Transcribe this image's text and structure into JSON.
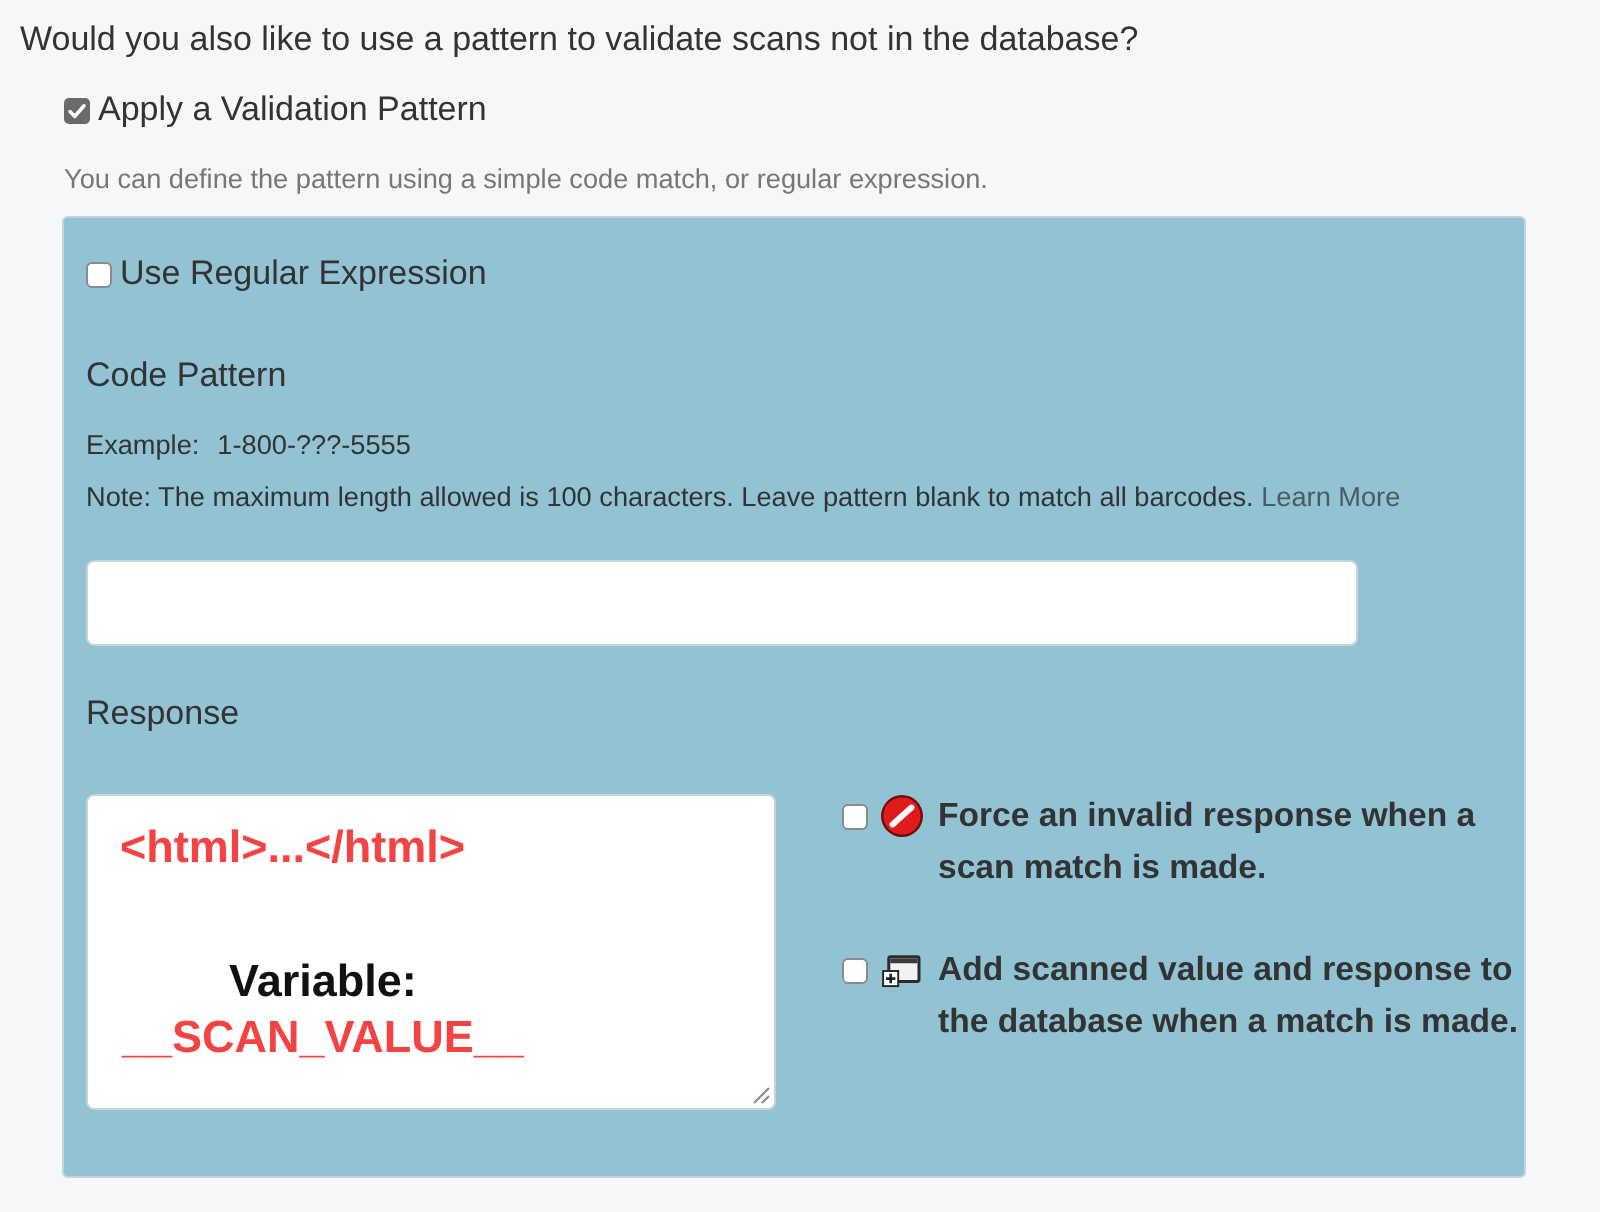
{
  "question": "Would you also like to use a pattern to validate scans not in the database?",
  "apply_pattern": {
    "label": "Apply a Validation Pattern",
    "checked": true
  },
  "help_text": "You can define the pattern using a simple code match, or regular expression.",
  "pattern_panel": {
    "regex": {
      "label": "Use Regular Expression",
      "checked": false
    },
    "code_pattern": {
      "label": "Code Pattern",
      "example_label": "Example:",
      "example_value": "1-800-???-5555",
      "note": "Note: The maximum length allowed is 100 characters. Leave pattern blank to match all barcodes.",
      "link": "Learn More"
    },
    "response": {
      "label": "Response",
      "editor_lines": [
        {
          "kind": "code",
          "text": "<html>...</html>"
        },
        {
          "kind": "caption",
          "text": "Variable:"
        },
        {
          "kind": "variable",
          "text": "__SCAN_VALUE__"
        }
      ]
    },
    "options": [
      {
        "kind": "invalid",
        "label": "Force an invalid response when a scan match is made.",
        "checked": false
      },
      {
        "kind": "add",
        "label": "Add scanned value and response to the database when a match is made.",
        "checked": false
      }
    ]
  }
}
